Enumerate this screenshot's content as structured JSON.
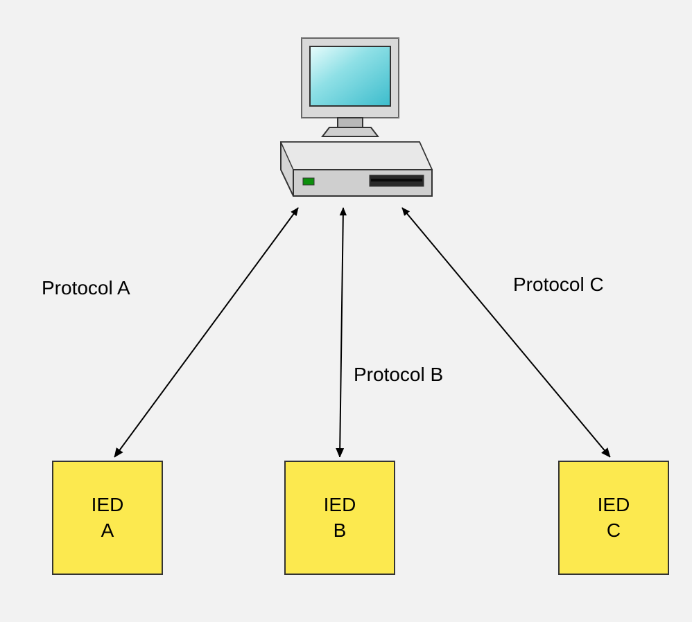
{
  "nodes": {
    "top": {
      "type": "computer"
    },
    "ied_a": {
      "line1": "IED",
      "line2": "A"
    },
    "ied_b": {
      "line1": "IED",
      "line2": "B"
    },
    "ied_c": {
      "line1": "IED",
      "line2": "C"
    }
  },
  "edges": {
    "a": {
      "label": "Protocol A"
    },
    "b": {
      "label": "Protocol B"
    },
    "c": {
      "label": "Protocol C"
    }
  }
}
